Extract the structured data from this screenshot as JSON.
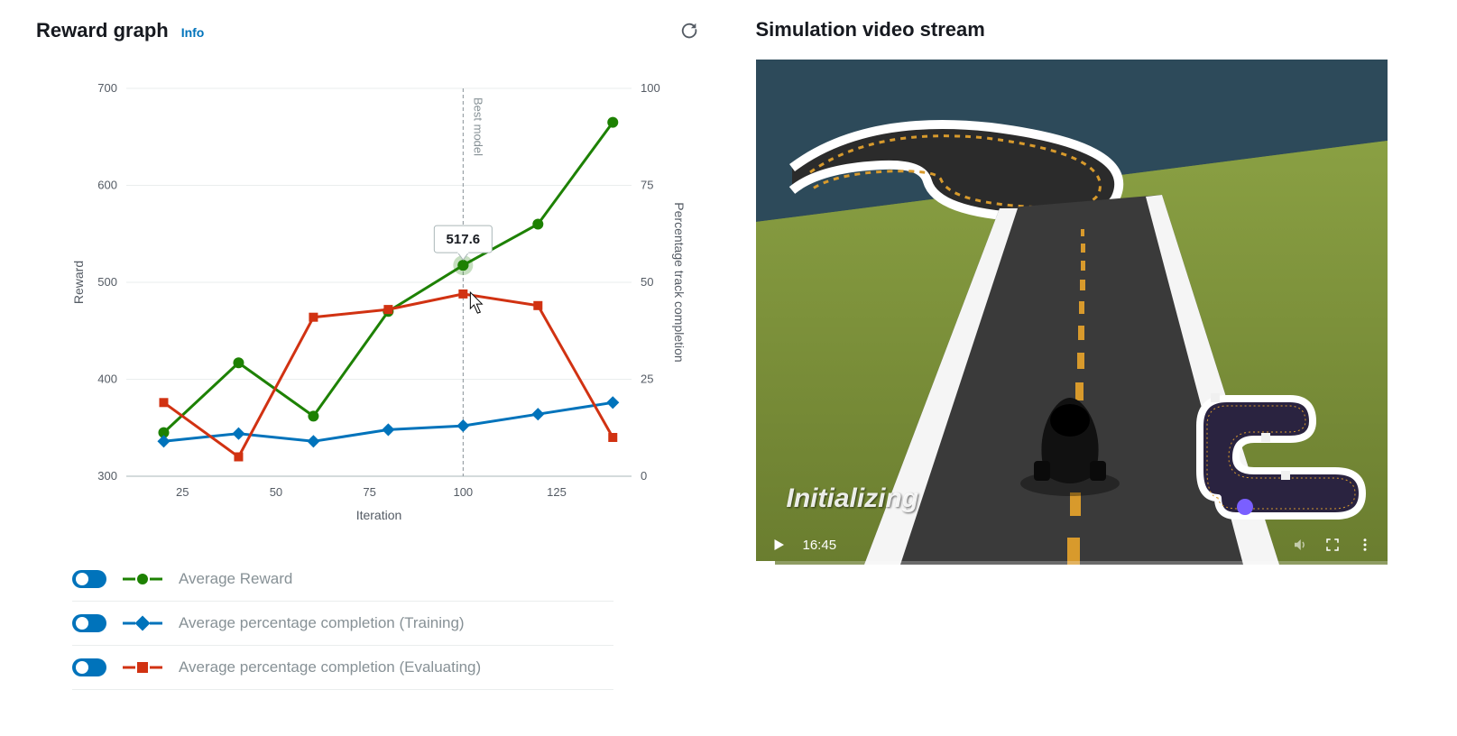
{
  "reward_panel": {
    "title": "Reward graph",
    "info": "Info"
  },
  "chart_data": {
    "type": "line",
    "xlabel": "Iteration",
    "ylabel_left": "Reward",
    "ylabel_right": "Percentage track completion",
    "x": [
      20,
      40,
      60,
      80,
      100,
      120,
      140
    ],
    "xlim": [
      10,
      145
    ],
    "ylim_left": [
      300,
      700
    ],
    "ylim_right": [
      0,
      100
    ],
    "x_ticks": [
      25,
      50,
      75,
      100,
      125
    ],
    "y_ticks_left": [
      300,
      400,
      500,
      600,
      700
    ],
    "y_ticks_right": [
      0,
      25,
      50,
      75,
      100
    ],
    "best_model_x": 100,
    "best_model_label": "Best model",
    "highlight": {
      "x": 100,
      "value": 517.6
    },
    "series": [
      {
        "name": "Average Reward",
        "axis": "left",
        "color": "#1d8102",
        "values": [
          345,
          417,
          362,
          470,
          517.6,
          560,
          665
        ],
        "marker": "circle"
      },
      {
        "name": "Average percentage completion (Training)",
        "axis": "right",
        "color": "#0073bb",
        "values": [
          9,
          11,
          9,
          12,
          13,
          16,
          19
        ],
        "marker": "diamond"
      },
      {
        "name": "Average percentage completion (Evaluating)",
        "axis": "right",
        "color": "#d13212",
        "values": [
          19,
          5,
          41,
          43,
          47,
          44,
          10
        ],
        "marker": "square"
      }
    ]
  },
  "legend": [
    "Average Reward",
    "Average percentage completion (Training)",
    "Average percentage completion (Evaluating)"
  ],
  "video_panel": {
    "title": "Simulation video stream",
    "status_text": "Initializing",
    "time": "16:45"
  }
}
